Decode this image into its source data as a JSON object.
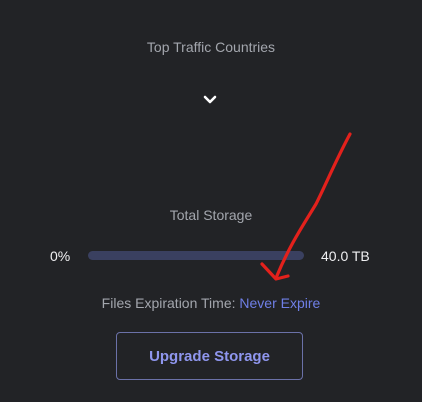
{
  "traffic": {
    "title": "Top Traffic Countries",
    "toggle_icon": "chevron-down-icon"
  },
  "storage": {
    "title": "Total Storage",
    "used_label": "0%",
    "used_fraction": 0,
    "total_label": "40.0 TB"
  },
  "expiration": {
    "label": "Files Expiration Time:",
    "value": "Never Expire"
  },
  "upgrade_button": {
    "label": "Upgrade Storage"
  },
  "colors": {
    "background": "#222326",
    "accent": "#6f7fe6",
    "track": "#3a4060",
    "annotation": "#e3211c"
  }
}
